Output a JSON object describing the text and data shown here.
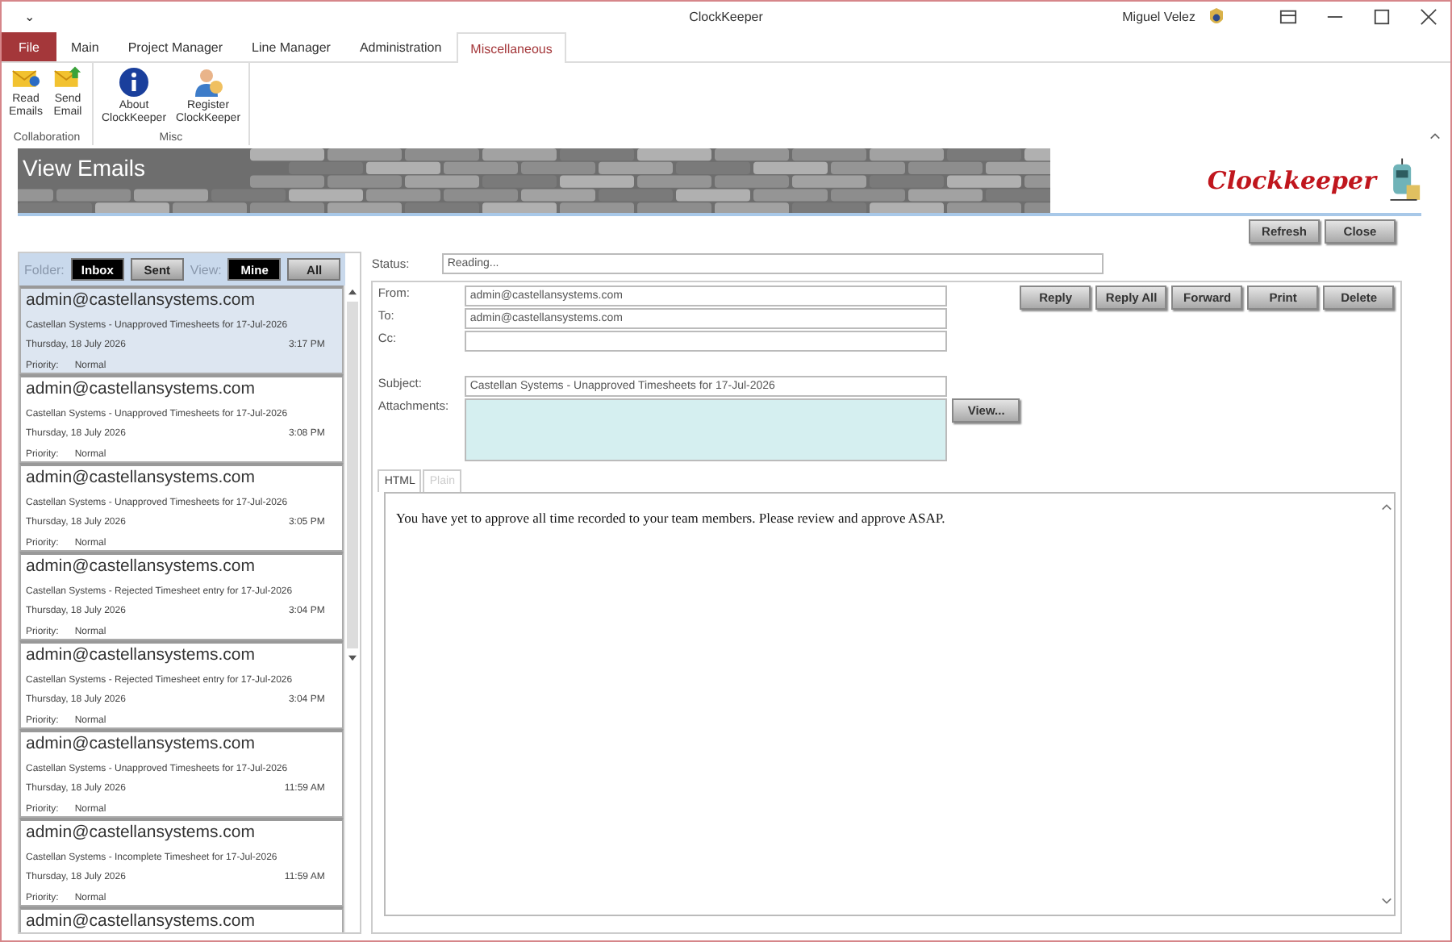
{
  "window": {
    "title": "ClockKeeper",
    "user": "Miguel Velez",
    "quick_access": "⌄"
  },
  "ribbon_tabs": [
    {
      "label": "File",
      "kind": "file",
      "selected": false
    },
    {
      "label": "Main",
      "kind": "tab",
      "selected": false
    },
    {
      "label": "Project Manager",
      "kind": "tab",
      "selected": false
    },
    {
      "label": "Line Manager",
      "kind": "tab",
      "selected": false
    },
    {
      "label": "Administration",
      "kind": "tab",
      "selected": false
    },
    {
      "label": "Miscellaneous",
      "kind": "tab",
      "selected": true
    }
  ],
  "ribbon_groups": [
    {
      "label": "Collaboration",
      "buttons": [
        {
          "label": "Read Emails",
          "kind": "mail-in"
        },
        {
          "label": "Send Email",
          "kind": "mail-out"
        }
      ]
    },
    {
      "label": "Misc",
      "buttons": [
        {
          "label": "About ClockKeeper",
          "kind": "info"
        },
        {
          "label": "Register ClockKeeper",
          "kind": "person"
        }
      ]
    }
  ],
  "banner": {
    "title": "View Emails",
    "logo": "Clockkeeper"
  },
  "toolbar": [
    "Refresh",
    "Close"
  ],
  "list_header": {
    "folder_label": "Folder:",
    "folders": [
      {
        "label": "Inbox",
        "selected": true
      },
      {
        "label": "Sent",
        "selected": false
      }
    ],
    "view_label": "View:",
    "views": [
      {
        "label": "Mine",
        "selected": true
      },
      {
        "label": "All",
        "selected": false
      }
    ]
  },
  "emails": [
    {
      "from": "admin@castellansystems.com",
      "subject": "Castellan Systems - Unapproved Timesheets for 17-Jul-2026",
      "date": "Thursday, 18 July 2026",
      "time": "3:17 PM",
      "priority_label": "Priority:",
      "priority": "Normal",
      "selected": true
    },
    {
      "from": "admin@castellansystems.com",
      "subject": "Castellan Systems - Unapproved Timesheets for 17-Jul-2026",
      "date": "Thursday, 18 July 2026",
      "time": "3:08 PM",
      "priority_label": "Priority:",
      "priority": "Normal",
      "selected": false
    },
    {
      "from": "admin@castellansystems.com",
      "subject": "Castellan Systems - Unapproved Timesheets for 17-Jul-2026",
      "date": "Thursday, 18 July 2026",
      "time": "3:05 PM",
      "priority_label": "Priority:",
      "priority": "Normal",
      "selected": false
    },
    {
      "from": "admin@castellansystems.com",
      "subject": "Castellan Systems - Rejected Timesheet entry for 17-Jul-2026",
      "date": "Thursday, 18 July 2026",
      "time": "3:04 PM",
      "priority_label": "Priority:",
      "priority": "Normal",
      "selected": false
    },
    {
      "from": "admin@castellansystems.com",
      "subject": "Castellan Systems - Rejected Timesheet entry for 17-Jul-2026",
      "date": "Thursday, 18 July 2026",
      "time": "3:04 PM",
      "priority_label": "Priority:",
      "priority": "Normal",
      "selected": false
    },
    {
      "from": "admin@castellansystems.com",
      "subject": "Castellan Systems - Unapproved Timesheets for 17-Jul-2026",
      "date": "Thursday, 18 July 2026",
      "time": "11:59 AM",
      "priority_label": "Priority:",
      "priority": "Normal",
      "selected": false
    },
    {
      "from": "admin@castellansystems.com",
      "subject": "Castellan Systems - Incomplete Timesheet for 17-Jul-2026",
      "date": "Thursday, 18 July 2026",
      "time": "11:59 AM",
      "priority_label": "Priority:",
      "priority": "Normal",
      "selected": false
    },
    {
      "from": "admin@castellansystems.com",
      "selected": false
    }
  ],
  "status": {
    "label": "Status:",
    "value": "Reading..."
  },
  "fields": [
    {
      "label": "From:",
      "value": "admin@castellansystems.com"
    },
    {
      "label": "To:",
      "value": "admin@castellansystems.com"
    },
    {
      "label": "Cc:"
    }
  ],
  "subject": {
    "label": "Subject:",
    "value": "Castellan Systems - Unapproved Timesheets for 17-Jul-2026"
  },
  "attachments": {
    "label": "Attachments:",
    "button": "View..."
  },
  "actions": [
    "Reply",
    "Reply All",
    "Forward",
    "Print",
    "Delete"
  ],
  "body_tabs": [
    {
      "label": "HTML",
      "selected": true
    },
    {
      "label": "Plain",
      "selected": false
    }
  ],
  "body": "You have yet to approve all time recorded to your team members. Please review and approve ASAP."
}
